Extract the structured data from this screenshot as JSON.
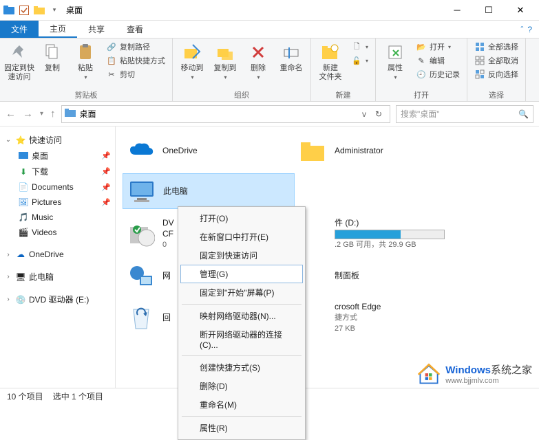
{
  "titlebar": {
    "title": "桌面"
  },
  "tabs": {
    "file": "文件",
    "home": "主页",
    "share": "共享",
    "view": "查看"
  },
  "ribbon": {
    "clipboard": {
      "label": "剪贴板",
      "pin": "固定到快\n速访问",
      "copy": "复制",
      "paste": "粘贴",
      "copypath": "复制路径",
      "pasteshortcut": "粘贴快捷方式",
      "cut": "剪切"
    },
    "organize": {
      "label": "组织",
      "moveto": "移动到",
      "copyto": "复制到",
      "delete": "删除",
      "rename": "重命名"
    },
    "new": {
      "label": "新建",
      "newfolder": "新建\n文件夹"
    },
    "open": {
      "label": "打开",
      "properties": "属性",
      "open": "打开",
      "edit": "编辑",
      "history": "历史记录"
    },
    "select": {
      "label": "选择",
      "selectall": "全部选择",
      "selectnone": "全部取消",
      "invert": "反向选择"
    }
  },
  "nav": {
    "location": "桌面",
    "searchPlaceholder": "搜索\"桌面\""
  },
  "sidebar": {
    "quickaccess": "快速访问",
    "items": [
      {
        "label": "桌面",
        "pin": true,
        "ic": "desktop"
      },
      {
        "label": "下载",
        "pin": true,
        "ic": "download"
      },
      {
        "label": "Documents",
        "pin": true,
        "ic": "docs"
      },
      {
        "label": "Pictures",
        "pin": true,
        "ic": "pics"
      },
      {
        "label": "Music",
        "pin": false,
        "ic": "music"
      },
      {
        "label": "Videos",
        "pin": false,
        "ic": "videos"
      }
    ],
    "onedrive": "OneDrive",
    "thispc": "此电脑",
    "dvd": "DVD 驱动器 (E:)"
  },
  "items": {
    "onedrive": "OneDrive",
    "admin": "Administrator",
    "thispc": "此电脑",
    "dvd": {
      "line1": "DV",
      "line2": "CF",
      "line3": "0"
    },
    "d_drive": {
      "name": "件 (D:)",
      "sub": ".2 GB 可用，共 29.9 GB"
    },
    "network": "网",
    "ctrlpanel": "制面板",
    "recycle": "回",
    "edge": {
      "name": "crosoft Edge",
      "sub1": "捷方式",
      "sub2": "27 KB"
    }
  },
  "context": {
    "open": "打开(O)",
    "newwindow": "在新窗口中打开(E)",
    "pinqa": "固定到快速访问",
    "manage": "管理(G)",
    "pinstart": "固定到\"开始\"屏幕(P)",
    "mapdrive": "映射网络驱动器(N)...",
    "disconnect": "断开网络驱动器的连接(C)...",
    "shortcut": "创建快捷方式(S)",
    "delete": "删除(D)",
    "rename": "重命名(M)",
    "properties": "属性(R)"
  },
  "status": {
    "count": "10 个项目",
    "selected": "选中 1 个项目"
  },
  "watermark": {
    "brand": "Windows",
    "suffix": "系统之家",
    "url": "www.bjjmlv.com"
  }
}
